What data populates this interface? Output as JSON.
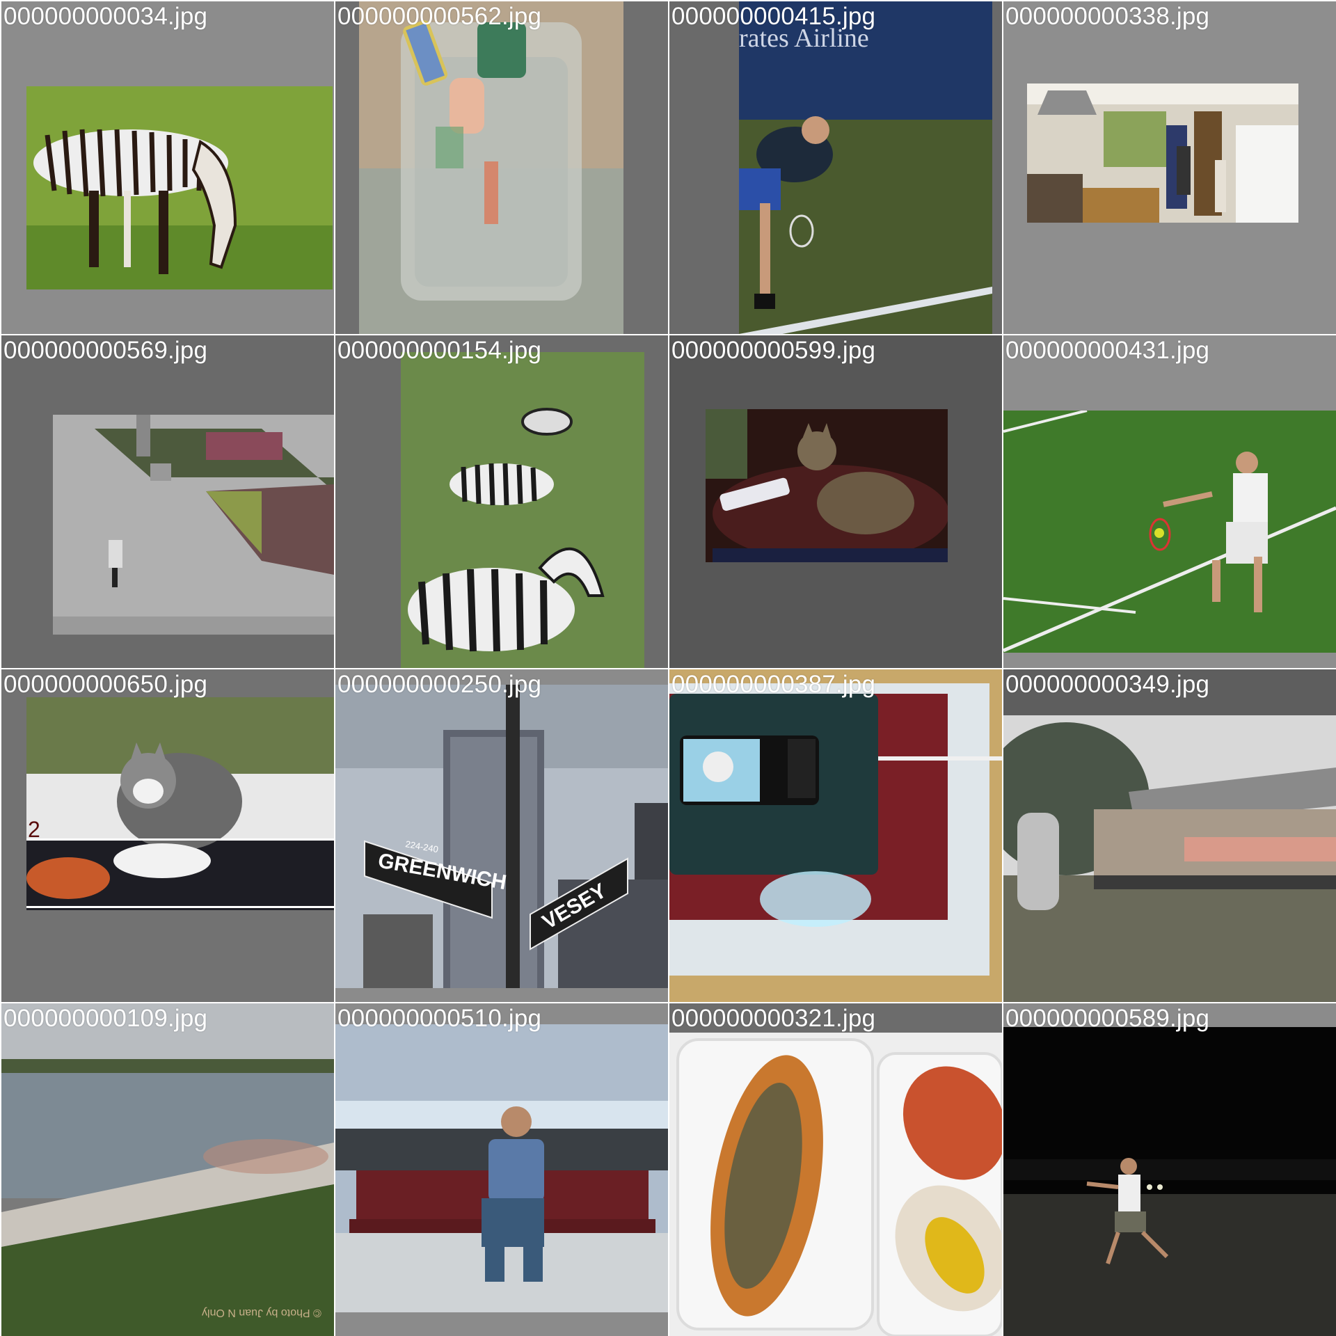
{
  "gallery": {
    "tiles": [
      {
        "filename": "000000000034.jpg",
        "scene": "zebra-grazing",
        "bg": "#8c8c8c"
      },
      {
        "filename": "000000000562.jpg",
        "scene": "toothbrushes-in-glass",
        "bg": "#6f6f6f"
      },
      {
        "filename": "000000000415.jpg",
        "scene": "tennis-serve-blue-court",
        "bg": "#6a6a6a",
        "overlay_text": "rates Airline"
      },
      {
        "filename": "000000000338.jpg",
        "scene": "kitchen",
        "bg": "#8e8e8e"
      },
      {
        "filename": "000000000569.jpg",
        "scene": "plaza-kite",
        "bg": "#6a6a6a"
      },
      {
        "filename": "000000000154.jpg",
        "scene": "three-zebras",
        "bg": "#6b6b6b"
      },
      {
        "filename": "000000000599.jpg",
        "scene": "cat-on-couch",
        "bg": "#575757"
      },
      {
        "filename": "000000000431.jpg",
        "scene": "tennis-forehand-grass",
        "bg": "#8e8e8e"
      },
      {
        "filename": "000000000650.jpg",
        "scene": "cat-on-car",
        "bg": "#727272",
        "overlay_text": "2"
      },
      {
        "filename": "000000000250.jpg",
        "scene": "street-signs",
        "bg": "#8b8b8b",
        "sign_1": "GREENWICH",
        "sign_1_small": "224-240",
        "sign_2": "VESEY"
      },
      {
        "filename": "000000000387.jpg",
        "scene": "laptop-phone",
        "bg": "#6a6a6a"
      },
      {
        "filename": "000000000349.jpg",
        "scene": "train-under-bridge",
        "bg": "#5e5e5e"
      },
      {
        "filename": "000000000109.jpg",
        "scene": "river-park",
        "bg": "#7a7a7a",
        "watermark": "© Photo by Juan N Only"
      },
      {
        "filename": "000000000510.jpg",
        "scene": "man-on-bench",
        "bg": "#8b8b8b"
      },
      {
        "filename": "000000000321.jpg",
        "scene": "hot-dogs",
        "bg": "#6c6c6c"
      },
      {
        "filename": "000000000589.jpg",
        "scene": "night-frisbee",
        "bg": "#8b8b8b"
      }
    ]
  }
}
